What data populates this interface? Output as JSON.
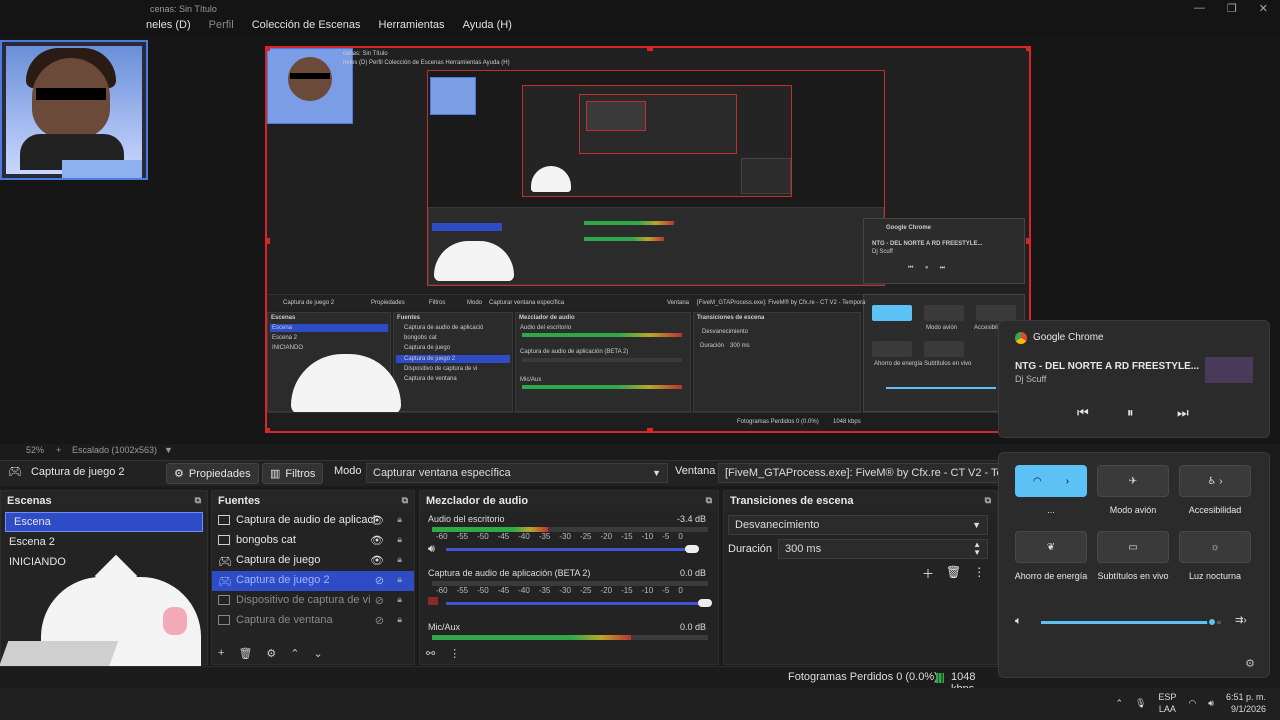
{
  "window": {
    "title": "cenas: Sin Título",
    "menu": [
      "neles (D)",
      "Perfil",
      "Colección de Escenas",
      "Herramientas",
      "Ayuda (H)"
    ],
    "controls": [
      "—",
      "❐",
      "✕"
    ]
  },
  "preview": {
    "zoom": "52%",
    "scale_label": "Escalado (1002x563)",
    "plus": "+"
  },
  "nested": {
    "menu": "neles (D)   Perfil   Colección de Escenas   Herramientas   Ayuda (H)",
    "title": "cenas: Sin Título",
    "source_label": "Captura de juego 2",
    "props": "Propiedades",
    "filters": "Filtros",
    "mode": "Modo",
    "mode_value": "Capturar ventana específica",
    "window": "Ventana",
    "window_value": "[FiveM_GTAProcess.exe]: FiveM® by Cfx.re - CT V2 - Tempora",
    "docks": [
      "Escenas",
      "Fuentes",
      "Mezclador de audio",
      "Transiciones de escena"
    ],
    "scenes": [
      "Escena",
      "Escena 2",
      "INICIANDO"
    ],
    "sources": [
      "Captura de audio de aplicació",
      "bongobs cat",
      "Captura de juego",
      "Captura de juego 2",
      "Dispositivo de captura de vi",
      "Captura de ventana"
    ],
    "mixer": [
      "Audio del escritorio",
      "Captura de audio de aplicación (BETA 2)",
      "Mic/Aux"
    ],
    "transition": "Desvanecimiento",
    "duration": "Duración",
    "duration_value": "300 ms",
    "status": "Fotogramas Perdidos 0 (0.0%)",
    "kbps": "1048 kbps",
    "chrome_app": "Google Chrome",
    "chrome_song": "NTG - DEL NORTE A RD FREESTYLE...",
    "chrome_artist": "Dj Scuff",
    "tiles": [
      "Modo avión",
      "Accesibilidad",
      "Ahorro de energía",
      "Subtítulos en vivo",
      "Luz nocturna"
    ],
    "tray_lang": "ESP\nLAA"
  },
  "toolbar": {
    "source_name": "Captura de juego 2",
    "properties": "Propiedades",
    "filters": "Filtros",
    "mode_label": "Modo",
    "mode_value": "Capturar ventana específica",
    "window_label": "Ventana",
    "window_value": "[FiveM_GTAProcess.exe]: FiveM® by Cfx.re - CT V2 - Tempora"
  },
  "scenes": {
    "title": "Escenas",
    "items": [
      "Escena",
      "Escena 2",
      "INICIANDO"
    ],
    "selected": 0
  },
  "sources": {
    "title": "Fuentes",
    "items": [
      {
        "label": "Captura de audio de aplicaci",
        "state": "normal"
      },
      {
        "label": "bongobs cat",
        "state": "normal"
      },
      {
        "label": "Captura de juego",
        "state": "normal"
      },
      {
        "label": "Captura de juego 2",
        "state": "selected"
      },
      {
        "label": "Dispositivo de captura de vi",
        "state": "dim"
      },
      {
        "label": "Captura de ventana",
        "state": "dim"
      }
    ],
    "footer": [
      "+",
      "🗑",
      "⚙",
      "⌃",
      "⌄"
    ]
  },
  "mixer": {
    "title": "Mezclador de audio",
    "channels": [
      {
        "name": "Audio del escritorio",
        "db": "-3.4 dB",
        "level": 0.42,
        "volume": 0.95
      },
      {
        "name": "Captura de audio de aplicación (BETA 2)",
        "db": "0.0 dB",
        "level": 0,
        "volume": 1.0
      },
      {
        "name": "Mic/Aux",
        "db": "0.0 dB",
        "level": 0.72,
        "volume": 1.0
      }
    ],
    "ticks": [
      "-60",
      "-55",
      "-50",
      "-45",
      "-40",
      "-35",
      "-30",
      "-25",
      "-20",
      "-15",
      "-10",
      "-5",
      "0"
    ]
  },
  "transitions": {
    "title": "Transiciones de escena",
    "value": "Desvanecimiento",
    "duration_label": "Duración",
    "duration_value": "300 ms"
  },
  "status": {
    "dropped": "Fotogramas Perdidos 0 (0.0%)",
    "kbps": "1048 kbps"
  },
  "media": {
    "app": "Google Chrome",
    "song": "NTG - DEL NORTE A RD FREESTYLE...",
    "artist": "Dj Scuff",
    "prev": "⏮",
    "pause": "⏸",
    "next": "⏭"
  },
  "quick": {
    "wifi_label": "...",
    "airplane": "Modo avión",
    "accessibility": "Accesibilidad",
    "energy": "Ahorro de energía",
    "subtitles": "Subtítulos en vivo",
    "night": "Luz nocturna",
    "volume": 0.95
  },
  "tray": {
    "lang1": "ESP",
    "lang2": "LAA",
    "time": "6:51 p. m.",
    "date": "9/1/2026"
  },
  "colors": {
    "accent": "#2f4cc7",
    "selection_red": "#d9252a",
    "tile_on": "#5cc2f5"
  }
}
